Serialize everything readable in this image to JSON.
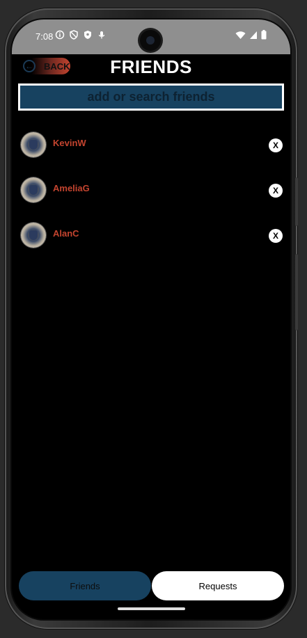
{
  "status_bar": {
    "time": "7:08",
    "left_icons": [
      "info-icon",
      "shield-outline-icon",
      "shield-icon",
      "mic-icon"
    ],
    "right_icons": [
      "wifi-icon",
      "signal-icon",
      "battery-icon"
    ]
  },
  "header": {
    "back_label": "BACK",
    "title": "FRIENDS"
  },
  "search": {
    "placeholder": "add or search friends"
  },
  "friends": [
    {
      "name": "KevinW",
      "remove_label": "X"
    },
    {
      "name": "AmeliaG",
      "remove_label": "X"
    },
    {
      "name": "AlanC",
      "remove_label": "X"
    }
  ],
  "tabs": {
    "friends_label": "Friends",
    "requests_label": "Requests"
  },
  "colors": {
    "accent_blue": "#174260",
    "name_red": "#c4442f",
    "background": "#000000"
  }
}
